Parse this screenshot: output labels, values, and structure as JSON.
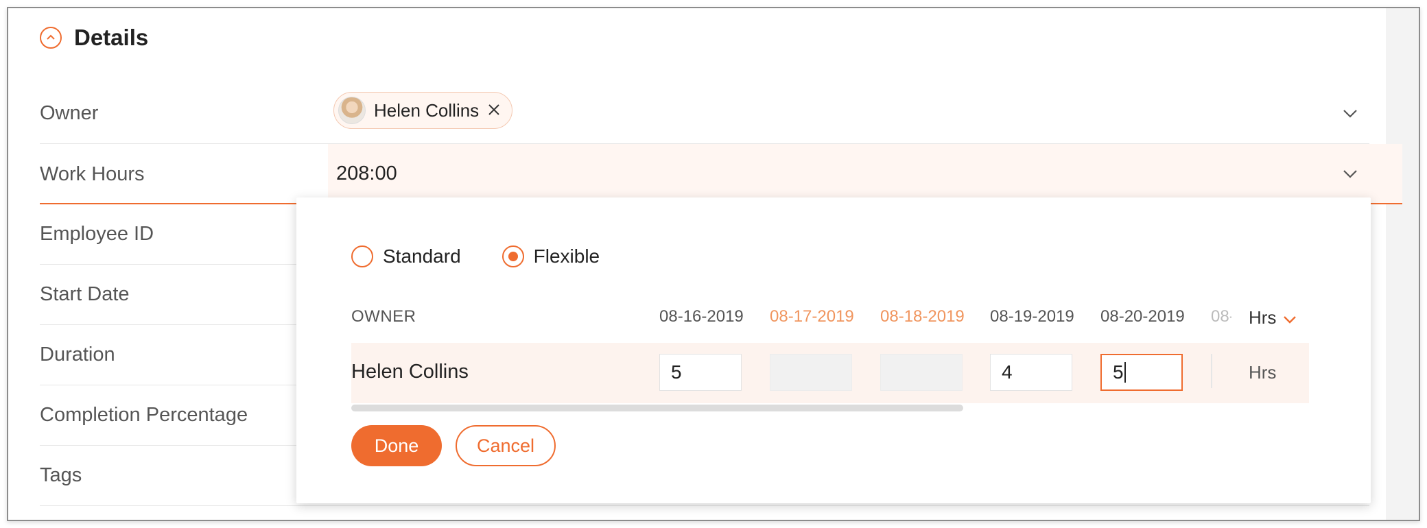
{
  "section": {
    "title": "Details"
  },
  "fields": {
    "owner": {
      "label": "Owner",
      "value": "Helen Collins"
    },
    "work_hours": {
      "label": "Work Hours",
      "value": "208:00"
    },
    "employee_id": {
      "label": "Employee ID"
    },
    "start_date": {
      "label": "Start Date"
    },
    "duration": {
      "label": "Duration"
    },
    "completion": {
      "label": "Completion Percentage"
    },
    "tags": {
      "label": "Tags"
    }
  },
  "popup": {
    "radio_standard": "Standard",
    "radio_flexible": "Flexible",
    "selected": "Flexible",
    "owner_header": "OWNER",
    "dates": [
      "08-16-2019",
      "08-17-2019",
      "08-18-2019",
      "08-19-2019",
      "08-20-2019",
      "08-"
    ],
    "unit_header": "Hrs",
    "row": {
      "name": "Helen Collins",
      "values": [
        "5",
        "",
        "",
        "4",
        "5"
      ],
      "unit": "Hrs"
    },
    "done_label": "Done",
    "cancel_label": "Cancel"
  },
  "colors": {
    "accent": "#ef6c2f",
    "weekend": "#f0955e"
  }
}
